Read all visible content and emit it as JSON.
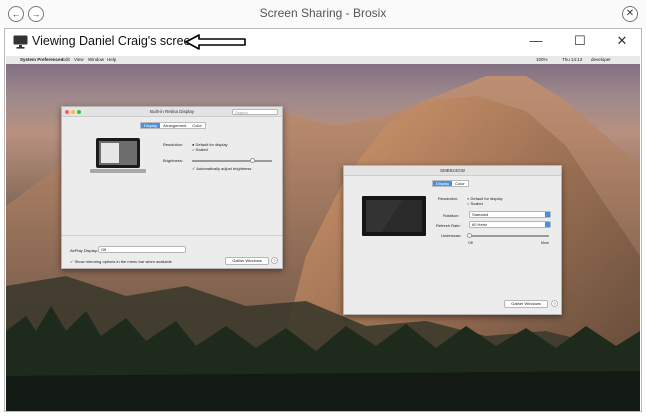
{
  "app": {
    "title": "Screen Sharing - Brosix",
    "back_glyph": "←",
    "forward_glyph": "→",
    "close_glyph": "✕"
  },
  "viewer": {
    "title": "Viewing Daniel Craig's screen",
    "minimize_glyph": "—",
    "maximize_glyph": "☐",
    "close_glyph": "✕"
  },
  "mac_menubar": {
    "apple": "",
    "items": [
      "System Preferences",
      "Edit",
      "View",
      "Window",
      "Help"
    ],
    "status": "100%",
    "clock": "Thu 14:13",
    "user": "developer"
  },
  "retina_panel": {
    "title": "Built-in Retina Display",
    "search_placeholder": "Search",
    "tabs": [
      "Display",
      "Arrangement",
      "Color"
    ],
    "resolution_label": "Resolution:",
    "opt_default": "Default for display",
    "opt_scaled": "Scaled",
    "brightness_label": "Brightness:",
    "auto_brightness": "Automatically adjust brightness",
    "airplay_label": "AirPlay Display:",
    "airplay_value": "Off",
    "mirroring_option": "Show mirroring options in the menu bar when available",
    "gather_button": "Gather Windows",
    "help": "?"
  },
  "external_panel": {
    "title": "SMB924GW",
    "tabs": [
      "Display",
      "Color"
    ],
    "resolution_label": "Resolution:",
    "opt_default": "Default for display",
    "opt_scaled": "Scaled",
    "rotation_label": "Rotation:",
    "rotation_value": "Standard",
    "refresh_label": "Refresh Rate:",
    "refresh_value": "60 Hertz",
    "underscan_label": "Underscan:",
    "underscan_off": "Off",
    "underscan_more": "More",
    "gather_button": "Gather Windows",
    "help": "?"
  },
  "colors": {
    "accent": "#4a90e2",
    "panel": "#ececec"
  }
}
